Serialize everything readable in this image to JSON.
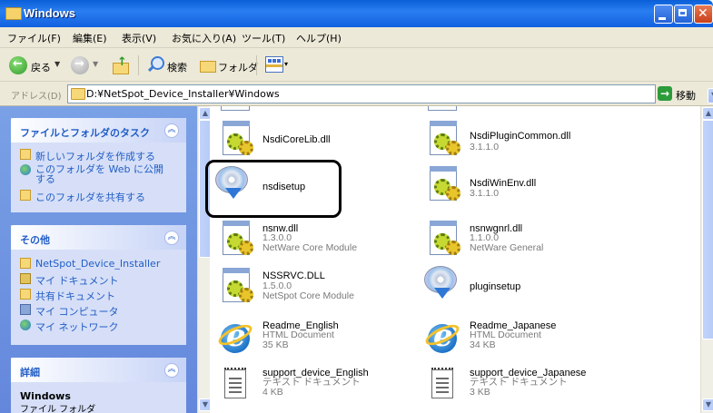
{
  "window": {
    "title": "Windows"
  },
  "menu": [
    "ファイル(F)",
    "編集(E)",
    "表示(V)",
    "お気に入り(A)",
    "ツール(T)",
    "ヘルプ(H)"
  ],
  "toolbar": {
    "back": "戻る",
    "search": "検索",
    "folders": "フォルダ"
  },
  "address": {
    "label": "アドレス(D)",
    "path": "D:¥NetSpot_Device_Installer¥Windows",
    "go": "移動"
  },
  "tasks_panel": {
    "title": "ファイルとフォルダのタスク",
    "items": [
      "新しいフォルダを作成する",
      "このフォルダを Web に公開する",
      "このフォルダを共有する"
    ]
  },
  "other_panel": {
    "title": "その他",
    "items": [
      "NetSpot_Device_Installer",
      "マイ ドキュメント",
      "共有ドキュメント",
      "マイ コンピュータ",
      "マイ ネットワーク"
    ]
  },
  "details_panel": {
    "title": "詳細",
    "name": "Windows",
    "type": "ファイル フォルダ"
  },
  "files": [
    {
      "name": "NsdiCoreLib.dll",
      "sub1": "",
      "sub2": "",
      "icon": "dll-gear-icon"
    },
    {
      "name": "NsdiPluginCommon.dll",
      "sub1": "3.1.1.0",
      "sub2": "",
      "icon": "dll-gear-icon"
    },
    {
      "name": "nsdisetup",
      "sub1": "",
      "sub2": "",
      "icon": "cd-installer-icon"
    },
    {
      "name": "NsdiWinEnv.dll",
      "sub1": "3.1.1.0",
      "sub2": "",
      "icon": "dll-gear-icon"
    },
    {
      "name": "nsnw.dll",
      "sub1": "1.3.0.0",
      "sub2": "NetWare Core Module",
      "icon": "dll-gear-icon"
    },
    {
      "name": "nsnwgnrl.dll",
      "sub1": "1.1.0.0",
      "sub2": "NetWare General",
      "icon": "dll-gear-icon"
    },
    {
      "name": "NSSRVC.DLL",
      "sub1": "1.5.0.0",
      "sub2": "NetSpot Core Module",
      "icon": "dll-gear-icon"
    },
    {
      "name": "pluginsetup",
      "sub1": "",
      "sub2": "",
      "icon": "cd-installer-icon"
    },
    {
      "name": "Readme_English",
      "sub1": "HTML Document",
      "sub2": "35 KB",
      "icon": "ie-document-icon"
    },
    {
      "name": "Readme_Japanese",
      "sub1": "HTML Document",
      "sub2": "34 KB",
      "icon": "ie-document-icon"
    },
    {
      "name": "support_device_English",
      "sub1": "テキスト ドキュメント",
      "sub2": "4 KB",
      "icon": "text-document-icon"
    },
    {
      "name": "support_device_Japanese",
      "sub1": "テキスト ドキュメント",
      "sub2": "3 KB",
      "icon": "text-document-icon"
    }
  ]
}
